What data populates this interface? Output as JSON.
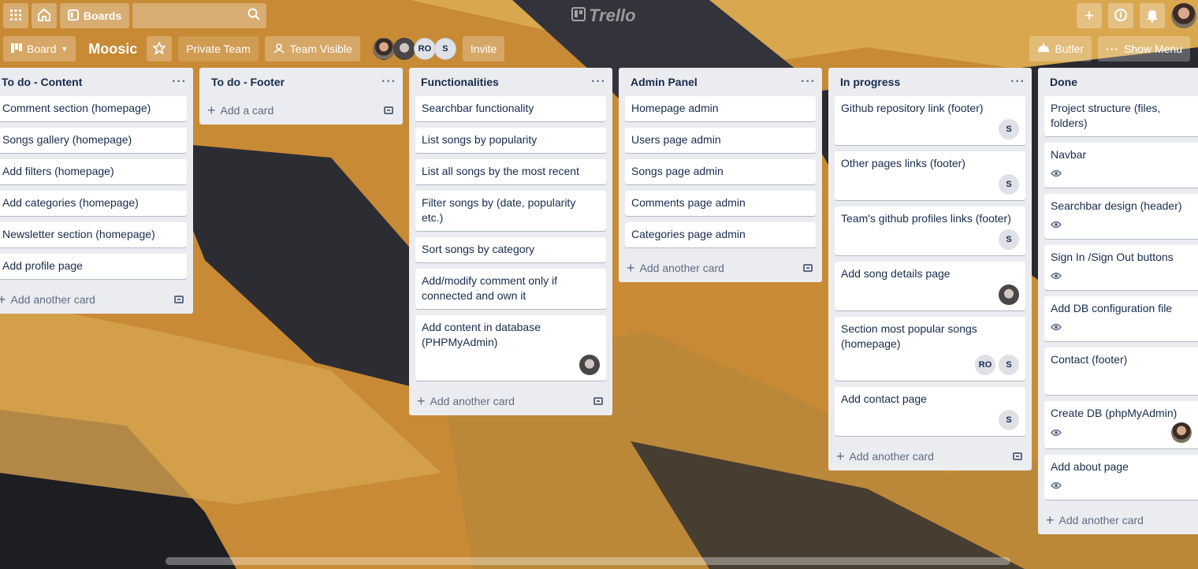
{
  "header": {
    "boards_label": "Boards",
    "logo_text": "Trello"
  },
  "board": {
    "view_label": "Board",
    "name": "Moosic",
    "team_label": "Private Team",
    "visibility_label": "Team Visible",
    "members": [
      "RO",
      "S"
    ],
    "invite_label": "Invite",
    "butler_label": "Butler",
    "menu_label": "Show Menu"
  },
  "lists": [
    {
      "title": "To do - Content",
      "cards": [
        {
          "title": "Comment section (homepage)"
        },
        {
          "title": "Songs gallery (homepage)"
        },
        {
          "title": "Add filters (homepage)"
        },
        {
          "title": "Add categories (homepage)"
        },
        {
          "title": "Newsletter section (homepage)"
        },
        {
          "title": "Add profile page"
        }
      ],
      "add_label": "Add another card"
    },
    {
      "title": "To do - Footer",
      "cards": [],
      "add_label": "Add a card"
    },
    {
      "title": "Functionalities",
      "cards": [
        {
          "title": "Searchbar functionality"
        },
        {
          "title": "List songs by popularity"
        },
        {
          "title": "List all songs by the most recent"
        },
        {
          "title": "Filter songs by (date, popularity etc.)"
        },
        {
          "title": "Sort songs by category"
        },
        {
          "title": "Add/modify comment only if connected and own it"
        },
        {
          "title": "Add content in database (PHPMyAdmin)"
        }
      ],
      "add_label": "Add another card"
    },
    {
      "title": "Admin Panel",
      "cards": [
        {
          "title": "Homepage admin"
        },
        {
          "title": "Users page admin"
        },
        {
          "title": "Songs page admin"
        },
        {
          "title": "Comments page admin"
        },
        {
          "title": "Categories page admin"
        }
      ],
      "add_label": "Add another card"
    },
    {
      "title": "In progress",
      "cards": [
        {
          "title": "Github repository link (footer)",
          "members": [
            "S"
          ]
        },
        {
          "title": "Other pages links (footer)",
          "members": [
            "S"
          ]
        },
        {
          "title": "Team's github profiles links (footer)",
          "members": [
            "S"
          ]
        },
        {
          "title": "Add song details page"
        },
        {
          "title": "Section most popular songs (homepage)",
          "members": [
            "RO",
            "S"
          ]
        },
        {
          "title": "Add contact page",
          "members": [
            "S"
          ]
        }
      ],
      "add_label": "Add another card"
    },
    {
      "title": "Done",
      "cards": [
        {
          "title": "Project structure (files, folders)"
        },
        {
          "title": "Navbar"
        },
        {
          "title": "Searchbar design (header)"
        },
        {
          "title": "Sign In /Sign Out buttons"
        },
        {
          "title": "Add DB configuration file"
        },
        {
          "title": "Contact (footer)"
        },
        {
          "title": "Create DB (phpMyAdmin)"
        },
        {
          "title": "Add about page"
        }
      ],
      "add_label": "Add another card"
    }
  ]
}
